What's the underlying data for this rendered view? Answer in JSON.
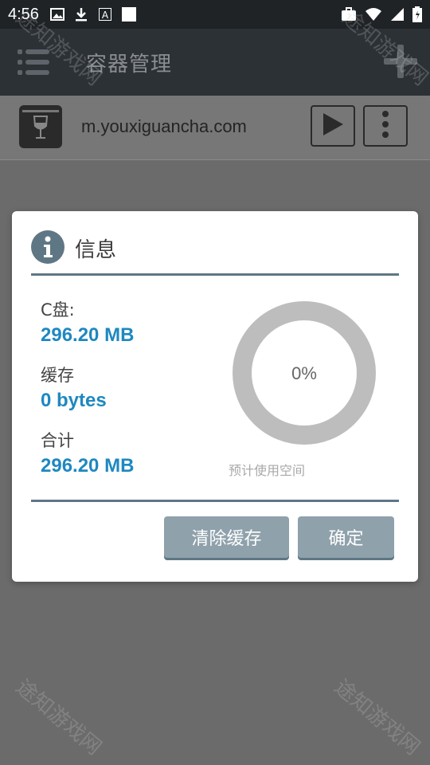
{
  "status_bar": {
    "time": "4:56",
    "left_icons": [
      "image-icon",
      "download-icon",
      "a-icon",
      "square-icon"
    ],
    "right_icons": [
      "briefcase-icon",
      "wifi-icon",
      "signal-icon",
      "battery-icon"
    ]
  },
  "app_bar": {
    "title": "容器管理",
    "menu_icon": "menu-icon",
    "add_icon": "plus-icon"
  },
  "container": {
    "url": "m.youxiguancha.com",
    "icon": "wine-glass-icon"
  },
  "dialog": {
    "title": "信息",
    "stats": [
      {
        "label": "C盘:",
        "value": "296.20 MB"
      },
      {
        "label": "缓存",
        "value": "0 bytes"
      },
      {
        "label": "合计",
        "value": "296.20 MB"
      }
    ],
    "donut": {
      "percent_text": "0%",
      "caption": "预计使用空间",
      "fraction": 0,
      "ring_color": "#bdbdbd"
    },
    "buttons": {
      "clear": "清除缓存",
      "ok": "确定"
    }
  },
  "watermark": "途知游戏网",
  "colors": {
    "accent": "#1e88c0",
    "divider": "#5f7784",
    "button": "#8fa1ab"
  }
}
